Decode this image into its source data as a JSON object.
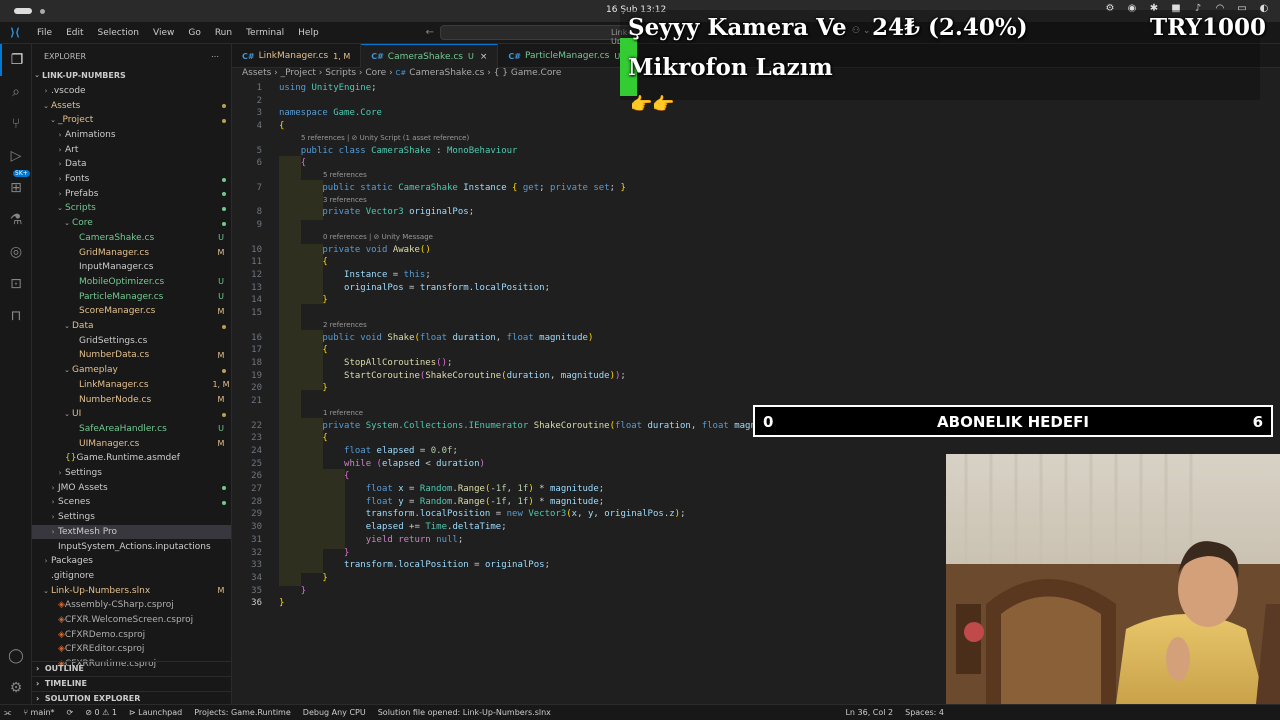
{
  "macbar": {
    "clock": "16 Şub 13:12"
  },
  "titlebar": {
    "menu": [
      "File",
      "Edit",
      "Selection",
      "View",
      "Go",
      "Run",
      "Terminal",
      "Help"
    ],
    "search_placeholder": "Link-Up-Numbers"
  },
  "activity": {
    "badge": "5K+"
  },
  "sidebar": {
    "header": "EXPLORER",
    "root": "LINK-UP-NUMBERS",
    "rows": [
      {
        "label": ".vscode",
        "indent": 1,
        "type": "folder",
        "chev": "›",
        "status": ""
      },
      {
        "label": "Assets",
        "indent": 1,
        "type": "folder-y",
        "chev": "⌄",
        "status": "dot-y"
      },
      {
        "label": "_Project",
        "indent": 2,
        "type": "folder-y",
        "chev": "⌄",
        "status": "dot-y"
      },
      {
        "label": "Animations",
        "indent": 3,
        "type": "folder",
        "chev": "›",
        "status": ""
      },
      {
        "label": "Art",
        "indent": 3,
        "type": "folder",
        "chev": "›",
        "status": ""
      },
      {
        "label": "Data",
        "indent": 3,
        "type": "folder",
        "chev": "›",
        "status": ""
      },
      {
        "label": "Fonts",
        "indent": 3,
        "type": "folder",
        "chev": "›",
        "status": "dot-g"
      },
      {
        "label": "Prefabs",
        "indent": 3,
        "type": "folder",
        "chev": "›",
        "status": "dot-g"
      },
      {
        "label": "Scripts",
        "indent": 3,
        "type": "folder-g",
        "chev": "⌄",
        "status": "dot-g"
      },
      {
        "label": "Core",
        "indent": 4,
        "type": "folder-g",
        "chev": "⌄",
        "status": "dot-g"
      },
      {
        "label": "CameraShake.cs",
        "indent": 5,
        "type": "file-g",
        "chev": "",
        "status": "U"
      },
      {
        "label": "GridManager.cs",
        "indent": 5,
        "type": "file-y",
        "chev": "",
        "status": "M"
      },
      {
        "label": "InputManager.cs",
        "indent": 5,
        "type": "file",
        "chev": "",
        "status": ""
      },
      {
        "label": "MobileOptimizer.cs",
        "indent": 5,
        "type": "file-g",
        "chev": "",
        "status": "U"
      },
      {
        "label": "ParticleManager.cs",
        "indent": 5,
        "type": "file-g",
        "chev": "",
        "status": "U"
      },
      {
        "label": "ScoreManager.cs",
        "indent": 5,
        "type": "file-y",
        "chev": "",
        "status": "M"
      },
      {
        "label": "Data",
        "indent": 4,
        "type": "folder-y",
        "chev": "⌄",
        "status": "dot-y"
      },
      {
        "label": "GridSettings.cs",
        "indent": 5,
        "type": "file",
        "chev": "",
        "status": ""
      },
      {
        "label": "NumberData.cs",
        "indent": 5,
        "type": "file-y",
        "chev": "",
        "status": "M"
      },
      {
        "label": "Gameplay",
        "indent": 4,
        "type": "folder-y",
        "chev": "⌄",
        "status": "dot-y"
      },
      {
        "label": "LinkManager.cs",
        "indent": 5,
        "type": "file-y",
        "chev": "",
        "status": "1, M"
      },
      {
        "label": "NumberNode.cs",
        "indent": 5,
        "type": "file-y",
        "chev": "",
        "status": "M"
      },
      {
        "label": "UI",
        "indent": 4,
        "type": "folder-y",
        "chev": "⌄",
        "status": "dot-y"
      },
      {
        "label": "SafeAreaHandler.cs",
        "indent": 5,
        "type": "file-g",
        "chev": "",
        "status": "U"
      },
      {
        "label": "UIManager.cs",
        "indent": 5,
        "type": "file-y",
        "chev": "",
        "status": "M"
      },
      {
        "label": "Game.Runtime.asmdef",
        "indent": 3,
        "type": "json",
        "chev": "",
        "status": ""
      },
      {
        "label": "Settings",
        "indent": 3,
        "type": "folder",
        "chev": "›",
        "status": ""
      },
      {
        "label": "JMO Assets",
        "indent": 2,
        "type": "folder",
        "chev": "›",
        "status": "dot-g"
      },
      {
        "label": "Scenes",
        "indent": 2,
        "type": "folder",
        "chev": "›",
        "status": "dot-g"
      },
      {
        "label": "Settings",
        "indent": 2,
        "type": "folder",
        "chev": "›",
        "status": ""
      },
      {
        "label": "TextMesh Pro",
        "indent": 2,
        "type": "folder",
        "chev": "›",
        "status": "",
        "sel": true
      },
      {
        "label": "InputSystem_Actions.inputactions",
        "indent": 2,
        "type": "file",
        "chev": "",
        "status": ""
      },
      {
        "label": "Packages",
        "indent": 1,
        "type": "folder",
        "chev": "›",
        "status": ""
      },
      {
        "label": ".gitignore",
        "indent": 1,
        "type": "file",
        "chev": "",
        "status": ""
      },
      {
        "label": "Link-Up-Numbers.slnx",
        "indent": 1,
        "type": "file-y",
        "chev": "⌄",
        "status": "M"
      },
      {
        "label": "Assembly-CSharp.csproj",
        "indent": 2,
        "type": "proj",
        "chev": "",
        "status": ""
      },
      {
        "label": "CFXR.WelcomeScreen.csproj",
        "indent": 2,
        "type": "proj",
        "chev": "",
        "status": ""
      },
      {
        "label": "CFXRDemo.csproj",
        "indent": 2,
        "type": "proj",
        "chev": "",
        "status": ""
      },
      {
        "label": "CFXREditor.csproj",
        "indent": 2,
        "type": "proj",
        "chev": "",
        "status": ""
      },
      {
        "label": "CFXRRuntime.csproj",
        "indent": 2,
        "type": "proj",
        "chev": "",
        "status": ""
      }
    ],
    "sections": [
      "OUTLINE",
      "TIMELINE",
      "SOLUTION EXPLORER"
    ]
  },
  "tabs": [
    {
      "label": "LinkManager.cs",
      "status": "1, M",
      "active": false
    },
    {
      "label": "CameraShake.cs",
      "status": "U",
      "active": true
    },
    {
      "label": "ParticleManager.cs",
      "status": "U",
      "active": false
    }
  ],
  "breadcrumb": [
    "Assets",
    "_Project",
    "Scripts",
    "Core",
    "CameraShake.cs",
    "Game.Core"
  ],
  "code": {
    "lines": [
      "<span class='kw'>using</span> <span class='ns'>UnityEngine</span>;",
      "",
      "<span class='kw'>namespace</span> <span class='ns'>Game.Core</span>",
      "<span class='br'>{</span>",
      "    <span class='kw'>public</span> <span class='kw'>class</span> <span class='ty'>CameraShake</span> : <span class='ty'>MonoBehaviour</span>",
      "    <span class='br2'>{</span>",
      "        <span class='kw'>public</span> <span class='kw'>static</span> <span class='ty'>CameraShake</span> <span class='vr'>Instance</span> <span class='br'>{</span> <span class='kw'>get</span>; <span class='kw'>private</span> <span class='kw'>set</span>; <span class='br'>}</span>",
      "        <span class='kw'>private</span> <span class='ty'>Vector3</span> <span class='vr'>originalPos</span>;",
      "",
      "        <span class='kw'>private</span> <span class='kw'>void</span> <span class='fn'>Awake</span><span class='br'>()</span>",
      "        <span class='br'>{</span>",
      "            <span class='vr'>Instance</span> = <span class='kw'>this</span>;",
      "            <span class='vr'>originalPos</span> = <span class='vr'>transform</span>.<span class='vr'>localPosition</span>;",
      "        <span class='br'>}</span>",
      "",
      "        <span class='kw'>public</span> <span class='kw'>void</span> <span class='fn'>Shake</span><span class='br'>(</span><span class='kw'>float</span> <span class='vr'>duration</span>, <span class='kw'>float</span> <span class='vr'>magnitude</span><span class='br'>)</span>",
      "        <span class='br'>{</span>",
      "            <span class='fn'>StopAllCoroutines</span><span class='br2'>()</span>;",
      "            <span class='fn'>StartCoroutine</span><span class='br2'>(</span><span class='fn'>ShakeCoroutine</span><span class='br'>(</span><span class='vr'>duration</span>, <span class='vr'>magnitude</span><span class='br'>)</span><span class='br2'>)</span>;",
      "        <span class='br'>}</span>",
      "",
      "        <span class='kw'>private</span> <span class='ty'>System.Collections.IEnumerator</span> <span class='fn'>ShakeCoroutine</span><span class='br'>(</span><span class='kw'>float</span> <span class='vr'>duration</span>, <span class='kw'>float</span> <span class='vr'>magnitude</span><span class='br'>)</span>",
      "        <span class='br'>{</span>",
      "            <span class='kw'>float</span> <span class='vr'>elapsed</span> = <span class='nm'>0.0f</span>;",
      "            <span class='ctl'>while</span> <span class='br2'>(</span><span class='vr'>elapsed</span> &lt; <span class='vr'>duration</span><span class='br2'>)</span>",
      "            <span class='br2'>{</span>",
      "                <span class='kw'>float</span> <span class='vr'>x</span> = <span class='ty'>Random</span>.<span class='fn'>Range</span><span class='br'>(</span>-<span class='nm'>1f</span>, <span class='nm'>1f</span><span class='br'>)</span> * <span class='vr'>magnitude</span>;",
      "                <span class='kw'>float</span> <span class='vr'>y</span> = <span class='ty'>Random</span>.<span class='fn'>Range</span><span class='br'>(</span>-<span class='nm'>1f</span>, <span class='nm'>1f</span><span class='br'>)</span> * <span class='vr'>magnitude</span>;",
      "                <span class='vr'>transform</span>.<span class='vr'>localPosition</span> = <span class='kw'>new</span> <span class='ty'>Vector3</span><span class='br'>(</span><span class='vr'>x</span>, <span class='vr'>y</span>, <span class='vr'>originalPos</span>.<span class='vr'>z</span><span class='br'>)</span>;",
      "                <span class='vr'>elapsed</span> += <span class='ty'>Time</span>.<span class='vr'>deltaTime</span>;",
      "                <span class='ctl'>yield</span> <span class='ctl'>return</span> <span class='kw'>null</span>;",
      "            <span class='br2'>}</span>",
      "            <span class='vr'>transform</span>.<span class='vr'>localPosition</span> = <span class='vr'>originalPos</span>;",
      "        <span class='br'>}</span>",
      "    <span class='br2'>}</span>",
      "<span class='br'>}</span>"
    ],
    "lenses": [
      {
        "before": 5,
        "text": "5 references | ⊘ Unity Script (1 asset reference)",
        "indent": 4
      },
      {
        "before": 7,
        "text": "5 references",
        "indent": 8
      },
      {
        "before": 8,
        "text": "3 references",
        "indent": 8
      },
      {
        "before": 10,
        "text": "0 references | ⊘ Unity Message",
        "indent": 8
      },
      {
        "before": 16,
        "text": "2 references",
        "indent": 8
      },
      {
        "before": 22,
        "text": "1 reference",
        "indent": 8
      }
    ]
  },
  "statusbar": {
    "items": [
      "⑂ main*",
      "⊘ 0 ⚠ 1",
      "⊳ Launchpad",
      "Projects: Game.Runtime",
      "Debug Any CPU",
      "Solution file opened: Link-Up-Numbers.slnx"
    ],
    "right": [
      "Ln 36, Col 2",
      "Spaces: 4"
    ]
  },
  "overlay": {
    "title1": "Şeyyy Kamera Ve",
    "title2": "Mikrofon Lazım",
    "price": "24₺ (2.40%)",
    "goal_amount": "TRY1000",
    "goal_left": "0",
    "goal_title": "ABONELIK HEDEFI",
    "goal_right": "6"
  },
  "colors": {
    "accent": "#0078d4",
    "modified": "#e2c08d",
    "untracked": "#73c991"
  }
}
